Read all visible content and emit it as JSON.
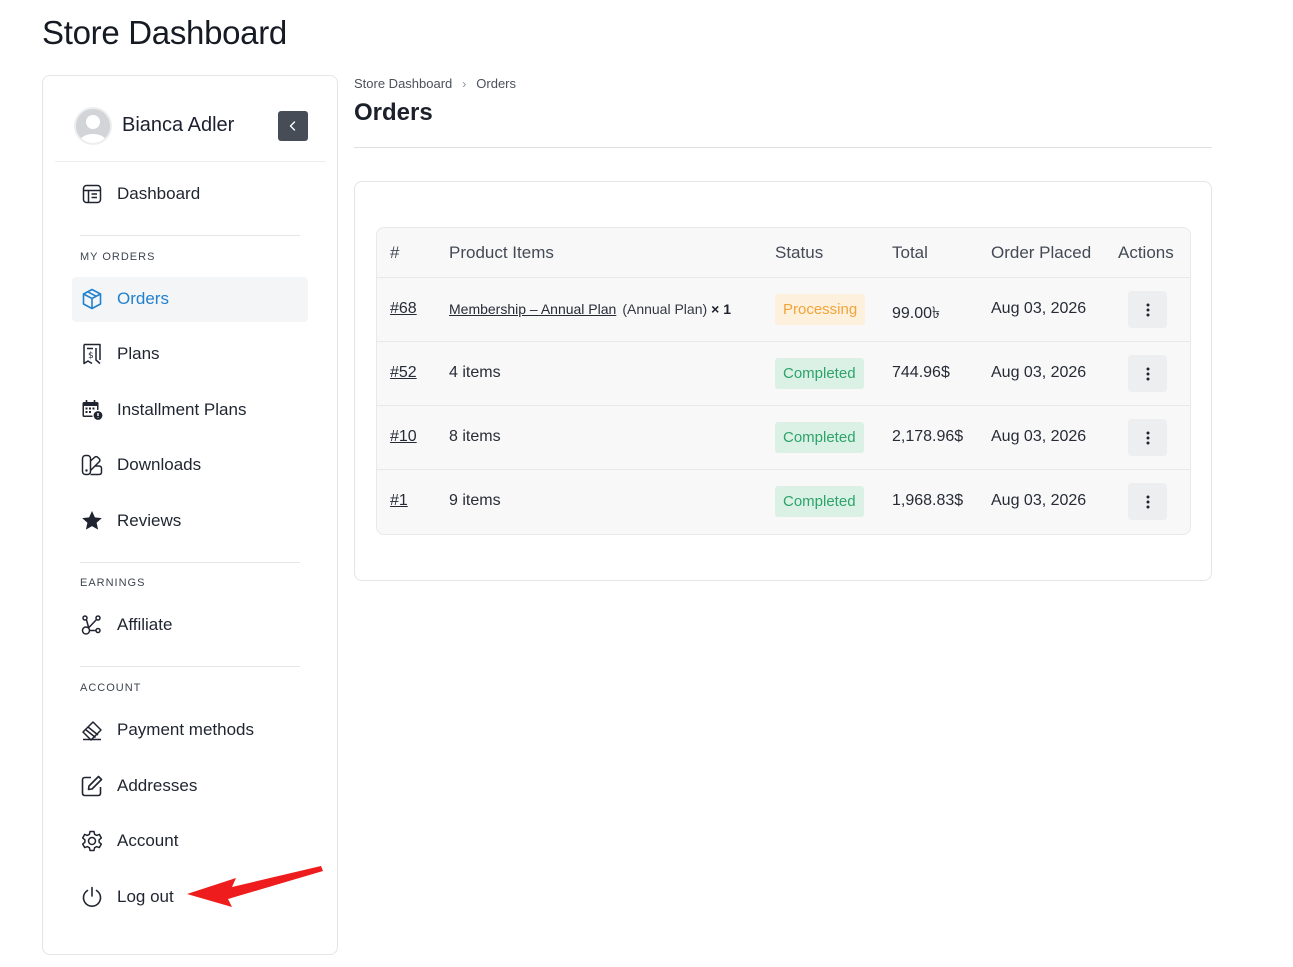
{
  "page": {
    "title": "Store Dashboard"
  },
  "sidebar": {
    "user_name": "Bianca Adler",
    "dashboard_label": "Dashboard",
    "sections": {
      "my_orders": "MY ORDERS",
      "earnings": "EARNINGS",
      "account": "ACCOUNT"
    },
    "items": {
      "orders": "Orders",
      "plans": "Plans",
      "installment_plans": "Installment Plans",
      "downloads": "Downloads",
      "reviews": "Reviews",
      "affiliate": "Affiliate",
      "payment_methods": "Payment methods",
      "addresses": "Addresses",
      "account": "Account",
      "log_out": "Log out"
    },
    "active_item": "orders"
  },
  "breadcrumb": [
    "Store Dashboard",
    "Orders"
  ],
  "section_title": "Orders",
  "table": {
    "headers": [
      "#",
      "Product Items",
      "Status",
      "Total",
      "Order Placed",
      "Actions"
    ],
    "rows": [
      {
        "order": "#68",
        "product": "Membership – Annual Plan",
        "variant": "(Annual Plan)",
        "qty": "× 1",
        "status": "Processing",
        "total": "99.00৳",
        "date": "Aug 03, 2026"
      },
      {
        "order": "#52",
        "items": "4 items",
        "status": "Completed",
        "total": "744.96$",
        "date": "Aug 03, 2026"
      },
      {
        "order": "#10",
        "items": "8 items",
        "status": "Completed",
        "total": "2,178.96$",
        "date": "Aug 03, 2026"
      },
      {
        "order": "#1",
        "items": "9 items",
        "status": "Completed",
        "total": "1,968.83$",
        "date": "Aug 03, 2026"
      }
    ]
  },
  "colors": {
    "accent": "#2281cf",
    "processing_bg": "#fdf0dd",
    "processing_text": "#f2a43a",
    "completed_bg": "#dcf1e6",
    "completed_text": "#2ba46a",
    "annotation_arrow": "#ee1c1c"
  },
  "icons": {
    "dashboard": "dashboard-icon",
    "orders": "box-icon",
    "plans": "receipt-icon",
    "installment_plans": "calendar-icon",
    "downloads": "download-icon",
    "reviews": "star-icon",
    "affiliate": "affiliate-icon",
    "payment_methods": "card-icon",
    "addresses": "edit-icon",
    "account": "gear-icon",
    "log_out": "power-icon"
  }
}
